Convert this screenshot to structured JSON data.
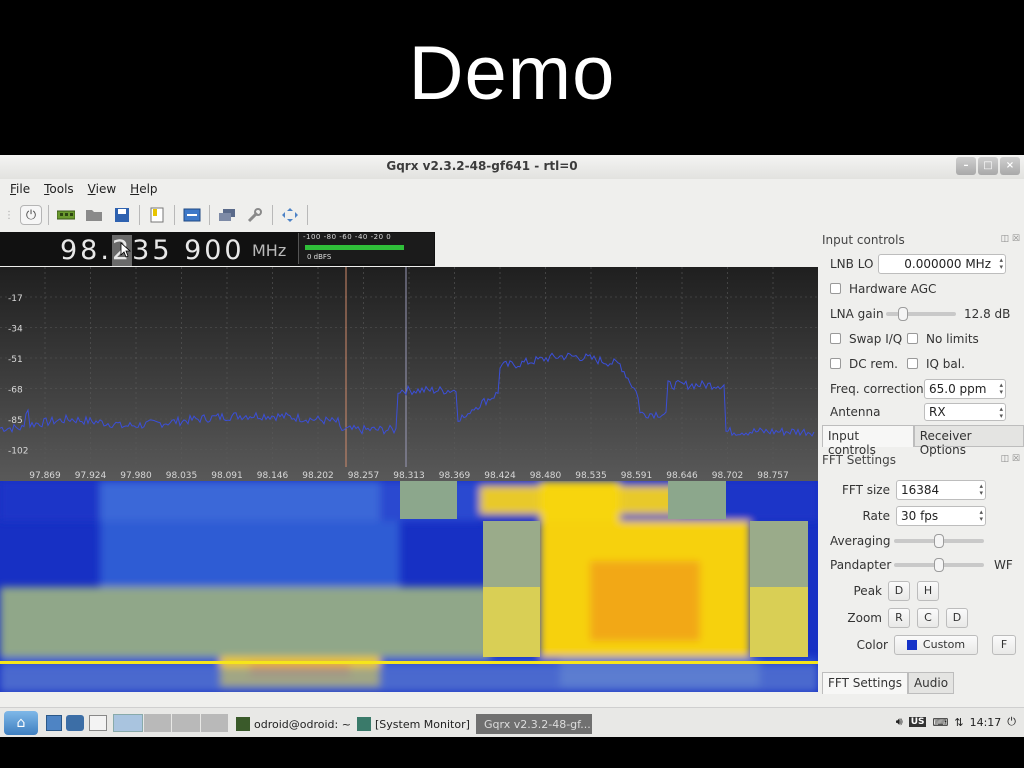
{
  "slide": {
    "title": "Demo"
  },
  "window": {
    "title": "Gqrx v2.3.2-48-gf641 - rtl=0",
    "controls": [
      "–",
      "□",
      "×"
    ]
  },
  "menu": [
    "File",
    "Tools",
    "View",
    "Help"
  ],
  "toolbar_icons": [
    "power-icon",
    "hardware-icon",
    "open-icon",
    "save-icon",
    "bookmark-icon",
    "display-icon",
    "network-icon",
    "tools-icon",
    "fullscreen-icon"
  ],
  "frequency": {
    "digits_pre": "98.",
    "digit_hl": "2",
    "digits_post": "35 900",
    "unit": "MHz"
  },
  "meter": {
    "scale": "-100  -80  -60  -40  -20   0",
    "label": "0 dBFS",
    "level": 0.8
  },
  "plot": {
    "y_ticks": [
      "-17",
      "-34",
      "-51",
      "-68",
      "-85",
      "-102"
    ],
    "x_ticks": [
      "97.869",
      "97.924",
      "97.980",
      "98.035",
      "98.091",
      "98.146",
      "98.202",
      "98.257",
      "98.313",
      "98.369",
      "98.424",
      "98.480",
      "98.535",
      "98.591",
      "98.646",
      "98.702",
      "98.757"
    ]
  },
  "input_controls": {
    "title": "Input controls",
    "lnb_lo_label": "LNB LO",
    "lnb_lo_value": "0.000000 MHz",
    "hw_agc": "Hardware AGC",
    "lna_label": "LNA gain",
    "lna_value": "12.8 dB",
    "swap_iq": "Swap I/Q",
    "no_limits": "No limits",
    "dc_rem": "DC rem.",
    "iq_bal": "IQ bal.",
    "freq_corr_label": "Freq. correction",
    "freq_corr_value": "65.0 ppm",
    "antenna_label": "Antenna",
    "antenna_value": "RX",
    "tab_input": "Input controls",
    "tab_receiver": "Receiver Options"
  },
  "fft_settings": {
    "title": "FFT Settings",
    "fft_size_label": "FFT size",
    "fft_size_value": "16384",
    "rate_label": "Rate",
    "rate_value": "30 fps",
    "averaging_label": "Averaging",
    "pandapter_label": "Pandapter",
    "wf_label": "WF",
    "peak_label": "Peak",
    "peak_d": "D",
    "peak_h": "H",
    "zoom_label": "Zoom",
    "zoom_r": "R",
    "zoom_c": "C",
    "zoom_d": "D",
    "color_label": "Color",
    "color_value": "Custom",
    "color_f": "F",
    "tab_fft": "FFT Settings",
    "tab_audio": "Audio"
  },
  "taskbar": {
    "tasks": [
      "odroid@odroid: ~",
      "[System Monitor]",
      "Gqrx v2.3.2-48-gf..."
    ],
    "clock": "14:17",
    "kbd": "US"
  },
  "colors": {
    "trace": "#3b4fd8",
    "wf_low": "#1a33c8",
    "wf_mid": "#8fb08a",
    "wf_high": "#f6d80a"
  }
}
